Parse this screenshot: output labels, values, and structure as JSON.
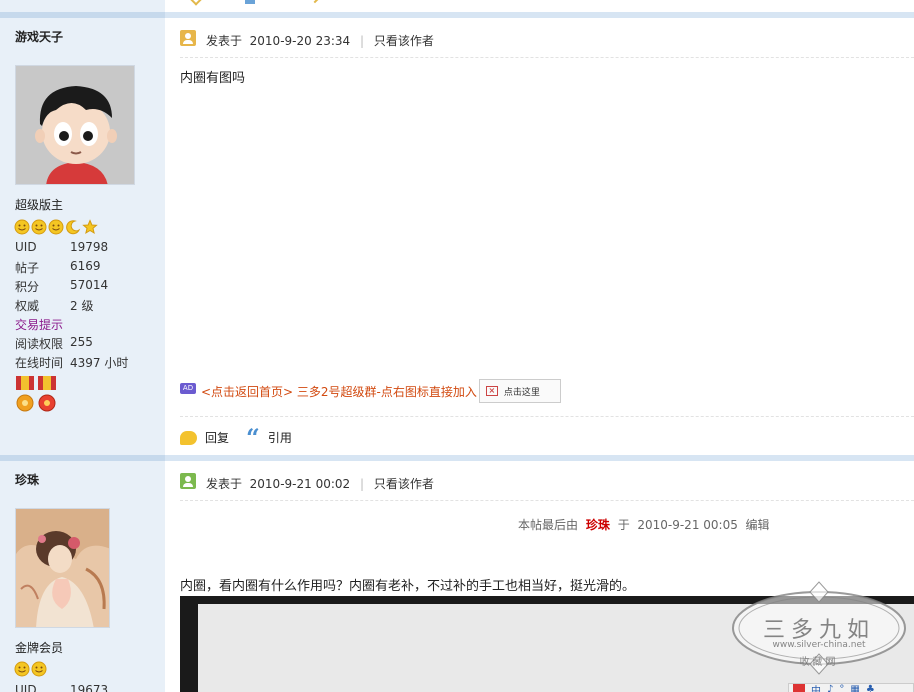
{
  "posts": [
    {
      "author": "游戏天子",
      "rank": "超级版主",
      "stats": [
        {
          "k": "UID",
          "v": "19798"
        },
        {
          "k": "帖子",
          "v": "6169"
        },
        {
          "k": "积分",
          "v": "57014"
        },
        {
          "k": "权威",
          "v": "2 级"
        },
        {
          "k": "交易提示",
          "v": ""
        },
        {
          "k": "阅读权限",
          "v": "255"
        },
        {
          "k": "在线时间",
          "v": "4397 小时"
        }
      ],
      "posted_label": "发表于",
      "posted_at": "2010-9-20 23:34",
      "only_author": "只看该作者",
      "body": "内圈有图吗",
      "ad_link": "<点击返回首页> 三多2号超级群-点右图标直接加入",
      "ad_button": "点击这里",
      "ad_icon_text": "AD",
      "reply_label": "回复",
      "quote_label": "引用"
    },
    {
      "author": "珍珠",
      "rank": "金牌会员",
      "stats": [
        {
          "k": "UID",
          "v": "19673"
        }
      ],
      "posted_label": "发表于",
      "posted_at": "2010-9-21 00:02",
      "only_author": "只看该作者",
      "edit_prefix": "本帖最后由",
      "edit_user": "珍珠",
      "edit_mid": "于",
      "edit_time": "2010-9-21 00:05",
      "edit_suffix": "编辑",
      "body": "内圈，看内圈有什么作用吗？内圈有老补，不过补的手工也相当好，挺光滑的。"
    }
  ],
  "watermark": {
    "title": "三多九如",
    "url": "www.silver-china.net",
    "sub": "收藏网"
  },
  "toolbar": {
    "items": [
      "中",
      "♪",
      "°",
      "▦",
      "♣"
    ]
  },
  "colors": {
    "sidebar_bg": "#e8f0f8",
    "separator": "#d7e5f3",
    "ad_link": "#d24a10",
    "trade_link": "#8b1a8b",
    "edit_user": "#cc0000"
  }
}
